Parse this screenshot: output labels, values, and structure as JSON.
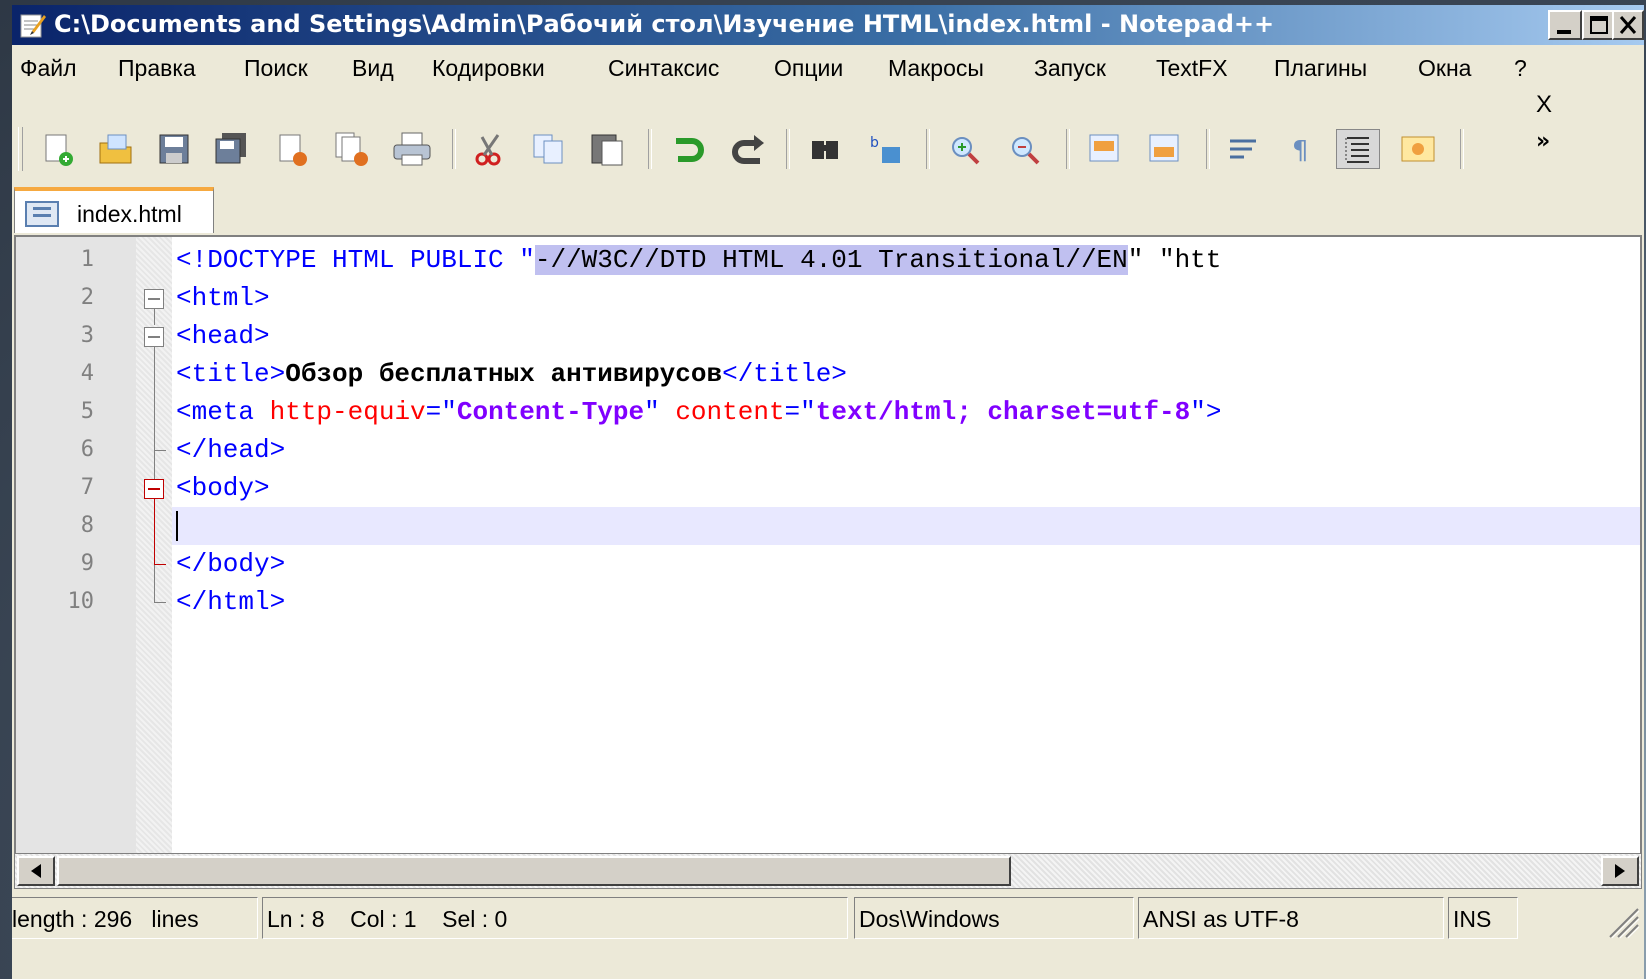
{
  "window": {
    "title": "C:\\Documents and Settings\\Admin\\Рабочий стол\\Изучение HTML\\index.html - Notepad++"
  },
  "menu": {
    "items": [
      "Файл",
      "Правка",
      "Поиск",
      "Вид",
      "Кодировки",
      "Синтаксис",
      "Опции",
      "Макросы",
      "Запуск",
      "TextFX",
      "Плагины",
      "Окна",
      "?"
    ],
    "close_doc": "X"
  },
  "toolbar": {
    "more": "»",
    "icons": [
      "new-file-icon",
      "open-file-icon",
      "save-icon",
      "save-all-icon",
      "close-icon",
      "close-all-icon",
      "print-icon",
      "cut-icon",
      "copy-icon",
      "paste-icon",
      "undo-icon",
      "redo-icon",
      "find-icon",
      "replace-icon",
      "zoom-in-icon",
      "zoom-out-icon",
      "sync-vertical-icon",
      "sync-horizontal-icon",
      "word-wrap-icon",
      "show-all-chars-icon",
      "indent-guide-icon",
      "user-defined-dialog-icon"
    ]
  },
  "tab": {
    "label": "index.html"
  },
  "editor": {
    "line_numbers": [
      "1",
      "2",
      "3",
      "4",
      "5",
      "6",
      "7",
      "8",
      "9",
      "10"
    ],
    "lines": [
      [
        "<!DOCTYPE HTML PUBLIC \"",
        "-//W3C//DTD HTML 4.01 Transitional//EN",
        "\" \"htt"
      ],
      [
        "<html>"
      ],
      [
        "<head>"
      ],
      [
        "<title>",
        "Обзор бесплатных антивирусов",
        "</title>"
      ],
      [
        "<meta ",
        "http-equiv",
        "=\"",
        "Content-Type",
        "\" ",
        "content",
        "=\"",
        "text/html; charset=utf-8",
        "\">"
      ],
      [
        "</head>"
      ],
      [
        "<body>"
      ],
      [
        ""
      ],
      [
        "</body>"
      ],
      [
        "</html>"
      ]
    ]
  },
  "status": {
    "length": "length : 296   lines",
    "position": "Ln : 8    Col : 1    Sel : 0",
    "eol": "Dos\\Windows",
    "encoding": "ANSI as UTF-8",
    "mode": "INS"
  },
  "colors": {
    "titlebar_start": "#0a246a",
    "tag": "#0000ff",
    "attribute": "#ff0000",
    "string": "#8000ff",
    "selection": "#c0c0f0",
    "current_line": "#e8e8ff",
    "tab_accent": "#f6a940"
  }
}
